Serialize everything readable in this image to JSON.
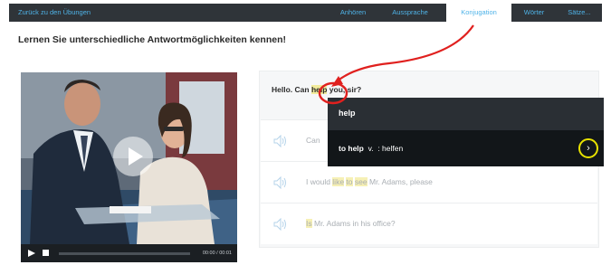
{
  "nav": {
    "back_label": "Zurück zu den Übungen",
    "tabs": [
      {
        "label": "Anhören"
      },
      {
        "label": "Aussprache"
      },
      {
        "label": "Konjugation"
      },
      {
        "label": "Wörter"
      },
      {
        "label": "Sätze..."
      }
    ],
    "active_tab": "Konjugation"
  },
  "page": {
    "heading": "Lernen Sie unterschiedliche Antwortmöglichkeiten kennen!"
  },
  "video": {
    "timecode": "00:00 / 00:01"
  },
  "sentences": {
    "main": {
      "before": "Hello. Can ",
      "highlight": "help",
      "after": " you, sir?"
    },
    "rows": [
      {
        "text": "Can"
      },
      {
        "parts": [
          "I would ",
          "like",
          " ",
          "to",
          " ",
          "see",
          " Mr. Adams, please"
        ]
      },
      {
        "parts": [
          "",
          "Is",
          " Mr. Adams in his office?"
        ]
      }
    ]
  },
  "popup": {
    "word": "help",
    "entry_term": "to help",
    "entry_pos": "v.",
    "entry_translation": ": helfen",
    "arrow": "›"
  },
  "colors": {
    "nav_bg": "#2f3439",
    "link": "#4fb3e8",
    "highlight": "#f2ec9c",
    "annotation_red": "#e0201e",
    "annotation_yellow": "#e8e200"
  },
  "icons": [
    "speaker-icon",
    "play-icon",
    "stop-icon",
    "chevron-right-icon"
  ]
}
